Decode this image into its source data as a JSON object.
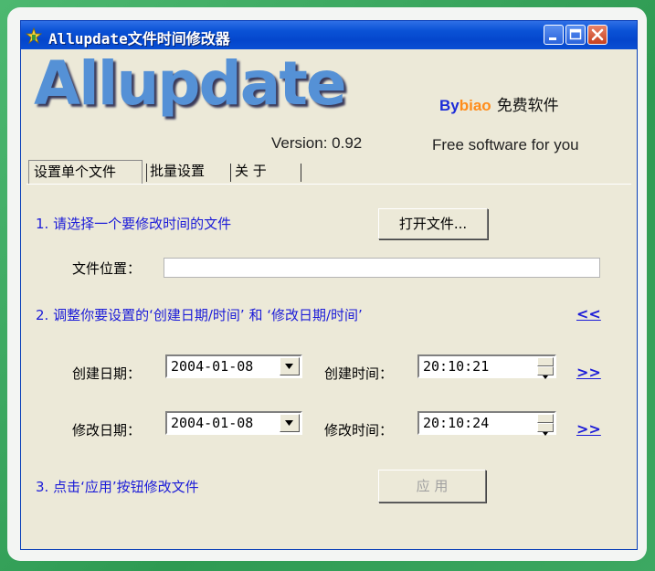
{
  "window": {
    "title": "Allupdate文件时间修改器"
  },
  "header": {
    "logo": "Allupdate",
    "version": "Version: 0.92",
    "by_prefix": "By",
    "by_name": "biao",
    "free_label": "免费软件",
    "tagline": "Free software for you"
  },
  "tabs": [
    {
      "label": "设置单个文件"
    },
    {
      "label": "批量设置"
    },
    {
      "label": "关 于"
    }
  ],
  "panel": {
    "step1": "1. 请选择一个要修改时间的文件",
    "open_button": "打开文件...",
    "file_location_label": "文件位置：",
    "file_location_value": "",
    "step2": "2. 调整你要设置的‘创建日期/时间’ 和 ‘修改日期/时间’",
    "link_back": "<<",
    "create_date_label": "创建日期：",
    "create_date_value": "2004-01-08",
    "create_time_label": "创建时间：",
    "create_time_value": "20:10:21",
    "link_create": ">>",
    "modify_date_label": "修改日期：",
    "modify_date_value": "2004-01-08",
    "modify_time_label": "修改时间：",
    "modify_time_value": "20:10:24",
    "link_modify": ">>",
    "step3": "3. 点击‘应用’按钮修改文件",
    "apply_button": "应 用"
  },
  "icons": {
    "app": "app-icon",
    "minimize": "minimize-icon",
    "maximize": "maximize-icon",
    "close": "close-icon",
    "dropdown": "dropdown-arrow-icon",
    "spin": "spin-arrows-icon"
  },
  "colors": {
    "titlebar": "#0a52d6",
    "window_bg": "#ece9d8",
    "step_text": "#1b1bd8",
    "logo": "#5591d6",
    "by": "#1b2bd8",
    "biao": "#ff8c1a",
    "close_button": "#c7401e"
  }
}
